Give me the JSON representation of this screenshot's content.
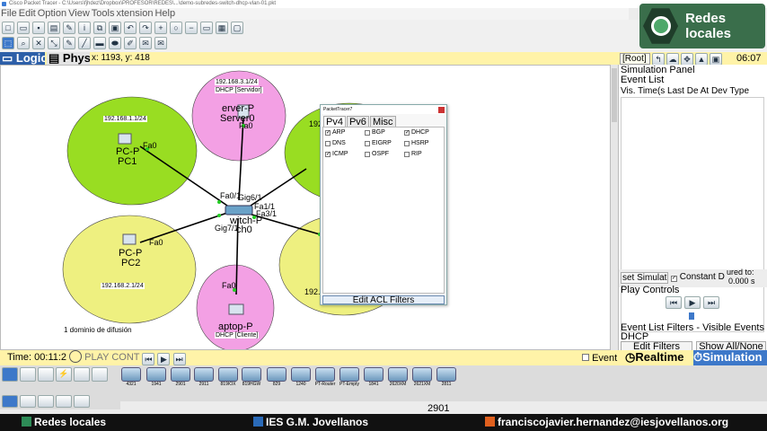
{
  "window": {
    "title": "Cisco Packet Tracer - C:\\Users\\fjhdez\\Dropbox\\PROFESOR\\REDES\\...\\demo-subredes-switch-dhcp-vlan-01.pkt"
  },
  "menu": [
    "File",
    "Edit",
    "Options",
    "View",
    "Tools",
    "Extensions",
    "Help"
  ],
  "menu_visible": [
    "File",
    "Edit",
    "Option",
    "View",
    "Tools",
    "xtension",
    "Help"
  ],
  "logo": {
    "text": "Redes locales"
  },
  "workspace": {
    "logical_tab": "Logic",
    "physical_tab": "Physi",
    "coords": "x: 1193, y: 418",
    "root_label": "[Root]",
    "clock": "06:07"
  },
  "network": {
    "pc1": {
      "subnet": "192.168.1.1/24",
      "name1": "PC-P",
      "name2": "PC1",
      "port": "Fa0"
    },
    "pc2": {
      "subnet": "192.168.2.1/24",
      "name1": "PC-P",
      "name2": "PC2",
      "port": "Fa0"
    },
    "server": {
      "subnet": "192.168.3.1/24",
      "role": "DHCP [Servidor]",
      "name1": "erver-P",
      "name2": "Server0",
      "port": "Fa0"
    },
    "laptop": {
      "role": "DHCP [Cliente]",
      "name1": "aptop-P",
      "port": "Fa0"
    },
    "right_top_subnet": "192.",
    "right_bottom_subnet": "192.16",
    "switch": {
      "name1": "witch-P",
      "name2": "ch0",
      "ports": [
        "Fa0/1",
        "Gig6/1",
        "Fa1/1",
        "Fa3/1",
        "Gig7/1"
      ]
    },
    "broadcast_note": "1 dominio de difusión"
  },
  "filter_dialog": {
    "title": "PacketTracer7",
    "tabs": [
      "Pv4",
      "Pv6",
      "Misc"
    ],
    "protocols": [
      {
        "name": "ARP",
        "checked": true
      },
      {
        "name": "BGP",
        "checked": false
      },
      {
        "name": "DHCP",
        "checked": true
      },
      {
        "name": "DNS",
        "checked": false
      },
      {
        "name": "EIGRP",
        "checked": false
      },
      {
        "name": "HSRP",
        "checked": false
      },
      {
        "name": "ICMP",
        "checked": true
      },
      {
        "name": "OSPF",
        "checked": false
      },
      {
        "name": "RIP",
        "checked": false
      }
    ],
    "acl_button": "Edit ACL Filters"
  },
  "sim_panel": {
    "title": "Simulation Panel",
    "event_list": "Event List",
    "columns": "Vis.  Time(s Last De At Dev Type",
    "reset_btn": "set Simulat",
    "constant_label": "Constant D",
    "captured_label": "ured to:",
    "captured_value": "0.000 s",
    "play_controls": "Play Controls",
    "filters_title": "Event List Filters - Visible Events",
    "filters_value": "DHCP",
    "edit_filters": "Edit Filters",
    "show_all": "Show All/None"
  },
  "timebar": {
    "time": "Time: 00:11:2",
    "play_label": "PLAY CONT"
  },
  "modes": {
    "event": "Event",
    "realtime": "Realtime",
    "simulation": "Simulation"
  },
  "devices": [
    "4321",
    "1941",
    "2901",
    "2911",
    "819IOX",
    "819HGW",
    "829",
    "1240",
    "PT-Router",
    "PT-Empty",
    "1841",
    "2620XM",
    "2621XM"
  ],
  "selected_model": "2901",
  "footer": {
    "left": "Redes locales",
    "center": "IES G.M. Jovellanos",
    "right": "franciscojavier.hernandez@iesjovellanos.org"
  },
  "colors": {
    "green_zone": "#99dd22",
    "yellow_zone": "#eef080",
    "pink_zone": "#f3a0e4",
    "footer_green": "#2e8b57",
    "footer_blue": "#2a6ab8",
    "footer_orange": "#e0601e"
  }
}
